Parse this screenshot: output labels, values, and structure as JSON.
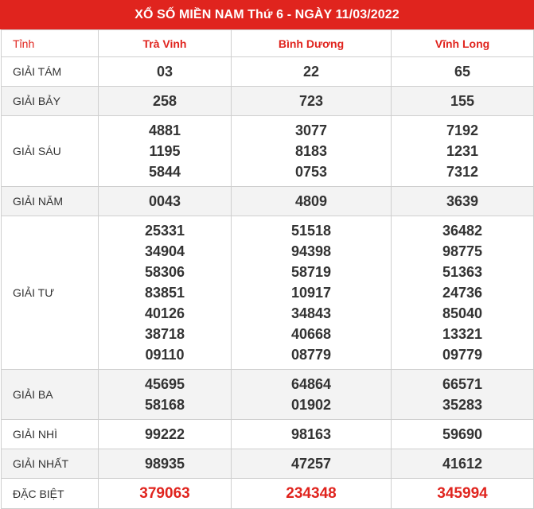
{
  "title": "XỔ SỐ MIỀN NAM Thứ 6 - NGÀY 11/03/2022",
  "header": {
    "label": "Tỉnh",
    "provinces": [
      "Trà Vinh",
      "Bình Dương",
      "Vĩnh Long"
    ]
  },
  "prizes": [
    {
      "name": "GIẢI TÁM",
      "values": [
        [
          "03"
        ],
        [
          "22"
        ],
        [
          "65"
        ]
      ]
    },
    {
      "name": "GIẢI BẢY",
      "values": [
        [
          "258"
        ],
        [
          "723"
        ],
        [
          "155"
        ]
      ]
    },
    {
      "name": "GIẢI SÁU",
      "values": [
        [
          "4881",
          "1195",
          "5844"
        ],
        [
          "3077",
          "8183",
          "0753"
        ],
        [
          "7192",
          "1231",
          "7312"
        ]
      ]
    },
    {
      "name": "GIẢI NĂM",
      "values": [
        [
          "0043"
        ],
        [
          "4809"
        ],
        [
          "3639"
        ]
      ]
    },
    {
      "name": "GIẢI TƯ",
      "values": [
        [
          "25331",
          "34904",
          "58306",
          "83851",
          "40126",
          "38718",
          "09110"
        ],
        [
          "51518",
          "94398",
          "58719",
          "10917",
          "34843",
          "40668",
          "08779"
        ],
        [
          "36482",
          "98775",
          "51363",
          "24736",
          "85040",
          "13321",
          "09779"
        ]
      ]
    },
    {
      "name": "GIẢI BA",
      "values": [
        [
          "45695",
          "58168"
        ],
        [
          "64864",
          "01902"
        ],
        [
          "66571",
          "35283"
        ]
      ]
    },
    {
      "name": "GIẢI NHÌ",
      "values": [
        [
          "99222"
        ],
        [
          "98163"
        ],
        [
          "59690"
        ]
      ]
    },
    {
      "name": "GIẢI NHẤT",
      "values": [
        [
          "98935"
        ],
        [
          "47257"
        ],
        [
          "41612"
        ]
      ]
    },
    {
      "name": "ĐẶC BIỆT",
      "values": [
        [
          "379063"
        ],
        [
          "234348"
        ],
        [
          "345994"
        ]
      ]
    }
  ]
}
